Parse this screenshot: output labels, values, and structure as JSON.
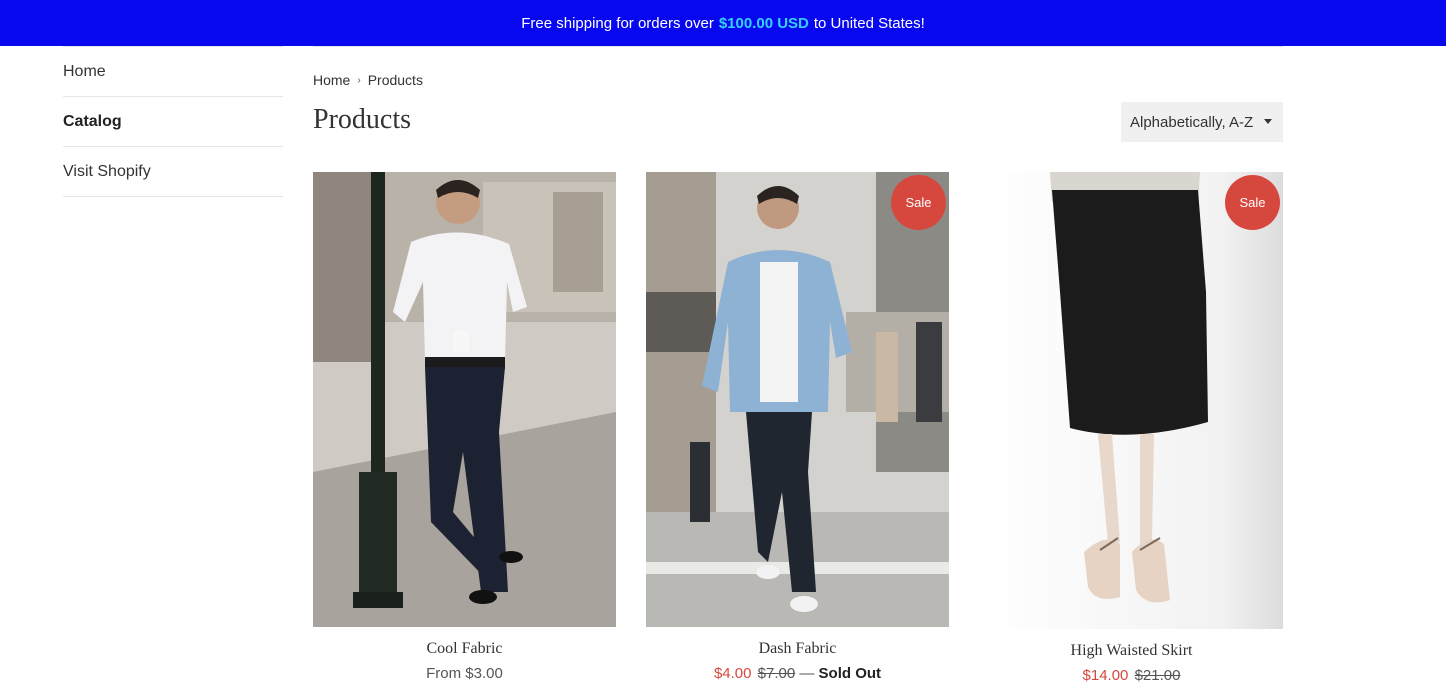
{
  "announcement": {
    "prefix": "Free shipping for orders over",
    "amount": "$100.00 USD",
    "suffix": "to United States!"
  },
  "sidebar": {
    "items": [
      {
        "label": "Home"
      },
      {
        "label": "Catalog"
      },
      {
        "label": "Visit Shopify"
      }
    ]
  },
  "breadcrumb": {
    "home": "Home",
    "current": "Products"
  },
  "page": {
    "title": "Products"
  },
  "sort": {
    "selected": "Alphabetically, A-Z"
  },
  "colors": {
    "announcement_bg": "#0808f0",
    "announcement_highlight": "#34d1ff",
    "sale": "#d6483e"
  },
  "products": [
    {
      "name": "Cool Fabric",
      "price_text": "From $3.00",
      "image_icon": "man-white-shirt-photo"
    },
    {
      "name": "Dash Fabric",
      "badge": "Sale",
      "sale_price": "$4.00",
      "original_price": "$7.00",
      "separator": "—",
      "status": "Sold Out",
      "image_icon": "man-denim-jacket-photo"
    },
    {
      "name": "High Waisted Skirt",
      "badge": "Sale",
      "sale_price": "$14.00",
      "original_price": "$21.00",
      "image_icon": "black-skirt-photo"
    }
  ]
}
